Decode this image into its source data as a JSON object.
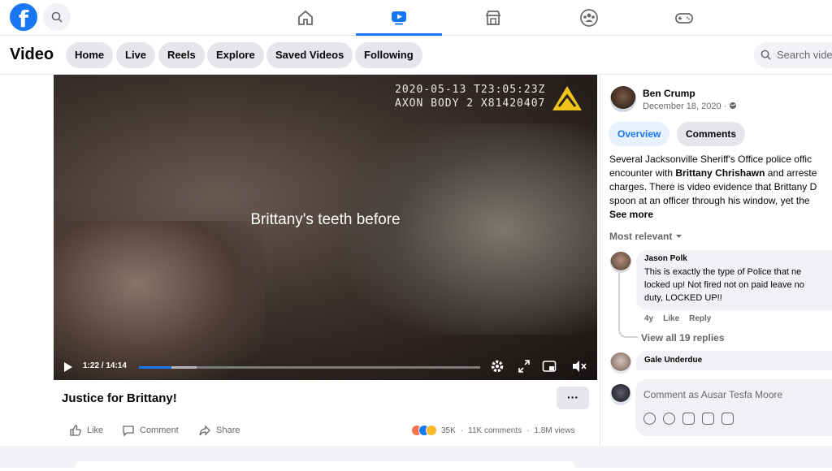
{
  "topnav": {
    "logo": "f",
    "tabs": [
      {
        "icon": "home-icon"
      },
      {
        "icon": "video-icon",
        "active": true
      },
      {
        "icon": "marketplace-icon"
      },
      {
        "icon": "groups-icon"
      },
      {
        "icon": "gaming-icon"
      }
    ],
    "colors": {
      "brand": "#1877f2"
    }
  },
  "subbar": {
    "title": "Video",
    "pills": [
      "Home",
      "Live",
      "Reels",
      "Explore",
      "Saved Videos",
      "Following"
    ],
    "search_placeholder": "Search vide"
  },
  "video": {
    "timestamp_line1": "2020-05-13 T23:05:23Z",
    "timestamp_line2": "AXON BODY 2 X81420407",
    "caption": "Brittany's teeth before",
    "time_display": "1:22 / 14:14",
    "progress_fraction": 0.096,
    "title": "Justice for Brittany!",
    "more_label": "···"
  },
  "actions": {
    "like": "Like",
    "comment": "Comment",
    "share": "Share",
    "reactions_count": "35K",
    "comments_count": "11K comments",
    "views": "1.8M views"
  },
  "post": {
    "author": "Ben Crump",
    "date": "December 18, 2020 ·",
    "tabs": [
      "Overview",
      "Comments"
    ],
    "description": {
      "line1": "Several Jacksonville Sheriff's Office police offic",
      "line2_pre": "encounter with ",
      "line2_bold": "Brittany Chrishawn",
      "line2_post": " and arreste",
      "line3": "charges. There is video evidence that Brittany D",
      "line4": "spoon at an officer through his window, yet the",
      "see_more": "See more"
    },
    "sort_label": "Most relevant"
  },
  "comments": [
    {
      "author": "Jason Polk",
      "lines": [
        "This is exactly the type of Police that ne",
        "locked up! Not fired not on paid leave no",
        "duty, LOCKED UP!!"
      ],
      "age": "4y",
      "like": "Like",
      "reply": "Reply",
      "view_replies": "View all 19 replies"
    },
    {
      "author": "Gale Underdue"
    }
  ],
  "composer": {
    "placeholder": "Comment as Ausar Tesfa Moore"
  }
}
